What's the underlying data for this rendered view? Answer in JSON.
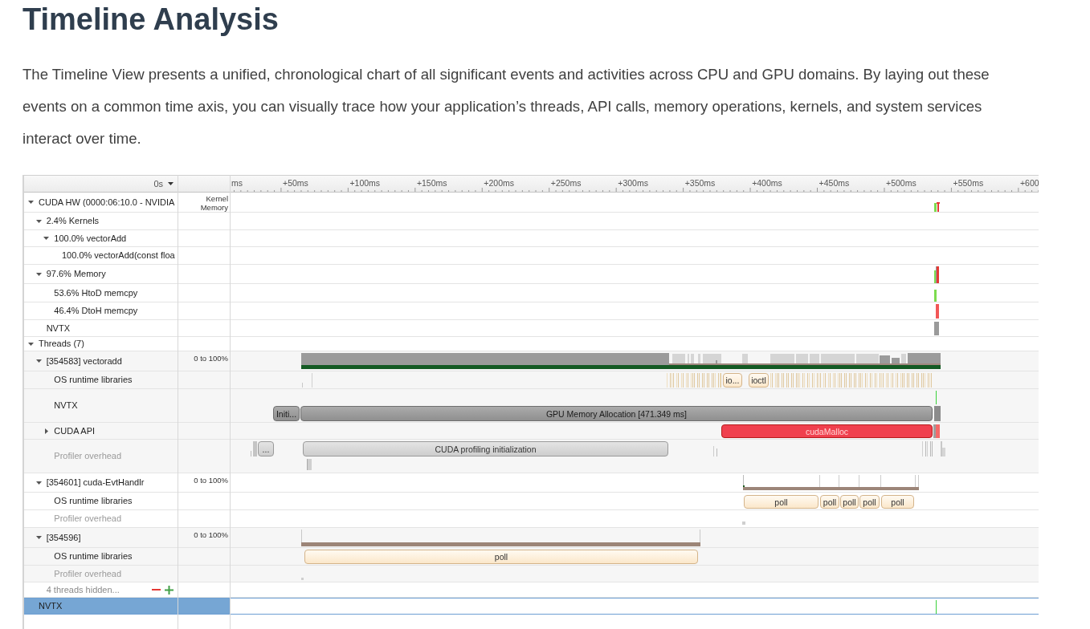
{
  "article": {
    "heading": "Timeline Analysis",
    "paragraph": "The Timeline View presents a unified, chronological chart of all significant events and activities across CPU and GPU domains. By laying out these events on a common time axis, you can visually trace how your application’s threads, API calls, memory operations, kernels, and system services interact over time."
  },
  "profiler": {
    "time_origin": "0s",
    "ruler_ticks": [
      "ms",
      "+50ms",
      "+100ms",
      "+150ms",
      "+200ms",
      "+250ms",
      "+300ms",
      "+350ms",
      "+400ms",
      "+450ms",
      "+500ms",
      "+550ms",
      "+600"
    ],
    "rows": [
      {
        "label": "CUDA HW (0000:06:10.0 - NVIDIA",
        "kind": "track",
        "expanded": true,
        "selected": false,
        "scale": "Kernel Memory",
        "children": [
          {
            "label": "2.4% Kernels",
            "kind": "track",
            "expanded": true,
            "selected": false,
            "children": [
              {
                "label": "100.0% vectorAdd",
                "kind": "track",
                "expanded": true,
                "selected": false,
                "children": [
                  {
                    "label": "100.0% vectorAdd(const floa",
                    "kind": "track",
                    "selected": false
                  }
                ]
              }
            ]
          },
          {
            "label": "97.6% Memory",
            "kind": "track",
            "expanded": true,
            "selected": false,
            "children": [
              {
                "label": "53.6% HtoD memcpy",
                "kind": "track",
                "selected": false
              },
              {
                "label": "46.4% DtoH memcpy",
                "kind": "track",
                "selected": false
              }
            ]
          },
          {
            "label": "NVTX",
            "kind": "track",
            "selected": false
          }
        ]
      },
      {
        "label": "Threads (7)",
        "kind": "track",
        "expanded": true,
        "selected": false,
        "children": [
          {
            "label": "[354583] vectoradd",
            "kind": "track",
            "expanded": true,
            "selected": false,
            "scale": "0 to 100%",
            "children": [
              {
                "label": "OS runtime libraries",
                "kind": "track",
                "selected": false,
                "events": [
                  {
                    "label": "io...",
                    "kind": "os"
                  },
                  {
                    "label": "ioctl",
                    "kind": "os"
                  }
                ]
              },
              {
                "label": "NVTX",
                "kind": "track",
                "selected": false,
                "events": [
                  {
                    "label": "Initi...",
                    "kind": "range"
                  },
                  {
                    "label": "GPU Memory Allocation [471.349 ms]",
                    "kind": "range"
                  }
                ]
              },
              {
                "label": "CUDA API",
                "kind": "track",
                "expanded": false,
                "selected": false,
                "events": [
                  {
                    "label": "cudaMalloc",
                    "kind": "api"
                  }
                ]
              },
              {
                "label": "Profiler overhead",
                "kind": "overhead",
                "selected": false,
                "events": [
                  {
                    "label": "...",
                    "kind": "marker"
                  },
                  {
                    "label": "CUDA profiling initialization",
                    "kind": "marker"
                  }
                ]
              }
            ]
          },
          {
            "label": "[354601] cuda-EvtHandlr",
            "kind": "track",
            "expanded": true,
            "selected": false,
            "scale": "0 to 100%",
            "children": [
              {
                "label": "OS runtime libraries",
                "kind": "track",
                "selected": false,
                "events": [
                  {
                    "label": "poll",
                    "kind": "os"
                  },
                  {
                    "label": "poll",
                    "kind": "os"
                  },
                  {
                    "label": "poll",
                    "kind": "os"
                  },
                  {
                    "label": "poll",
                    "kind": "os"
                  },
                  {
                    "label": "poll",
                    "kind": "os"
                  }
                ]
              },
              {
                "label": "Profiler overhead",
                "kind": "overhead",
                "selected": false
              }
            ]
          },
          {
            "label": "[354596]",
            "kind": "track",
            "expanded": true,
            "selected": false,
            "scale": "0 to 100%",
            "children": [
              {
                "label": "OS runtime libraries",
                "kind": "track",
                "selected": false,
                "events": [
                  {
                    "label": "poll",
                    "kind": "os"
                  }
                ]
              },
              {
                "label": "Profiler overhead",
                "kind": "overhead",
                "selected": false
              }
            ]
          },
          {
            "label": "4 threads hidden...",
            "kind": "note",
            "selected": false
          }
        ]
      },
      {
        "label": "NVTX",
        "kind": "track",
        "selected": true
      }
    ]
  }
}
